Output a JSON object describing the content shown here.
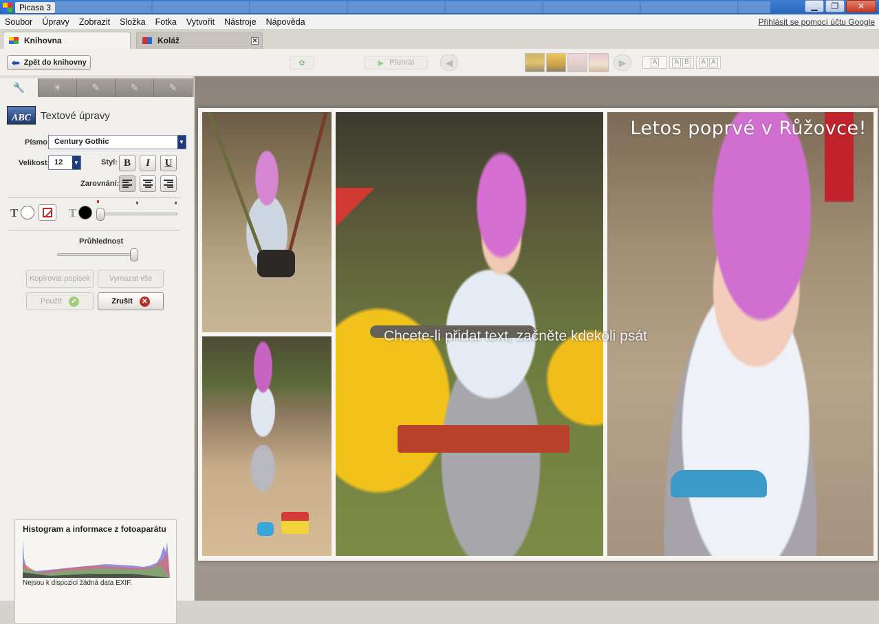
{
  "window": {
    "title": "Picasa 3"
  },
  "menu": [
    "Soubor",
    "Úpravy",
    "Zobrazit",
    "Složka",
    "Fotka",
    "Vytvořit",
    "Nástroje",
    "Nápověda"
  ],
  "signin_label": "Přihlásit se pomocí účtu Google",
  "tabs": {
    "library": "Knihovna",
    "collage": "Koláž"
  },
  "toolbar": {
    "back_label": "Zpět do knihovny",
    "play_label": "Přehrát"
  },
  "text_panel": {
    "title": "Textové úpravy",
    "icon_text": "ABC",
    "font_label": "Písmo:",
    "font_value": "Century Gothic",
    "size_label": "Velikost:",
    "size_value": "12",
    "style_label": "Styl:",
    "bold": "B",
    "italic": "I",
    "underline": "U",
    "align_label": "Zarovnání:",
    "opacity_label": "Průhlednost",
    "copy_caption": "Kopírovat popisek",
    "clear_all": "Vymazat vše",
    "apply": "Použít",
    "cancel": "Zrušit",
    "fill_color": "#ffffff",
    "outline_color": "#000000"
  },
  "histogram": {
    "title": "Histogram a informace z fotoaparátu",
    "exif_note": "Nejsou k dispozici žádná data EXIF."
  },
  "canvas": {
    "caption": "Letos poprvé v Růžovce!",
    "hint": "Chcete-li přidat text, začněte kdekoli psát"
  }
}
